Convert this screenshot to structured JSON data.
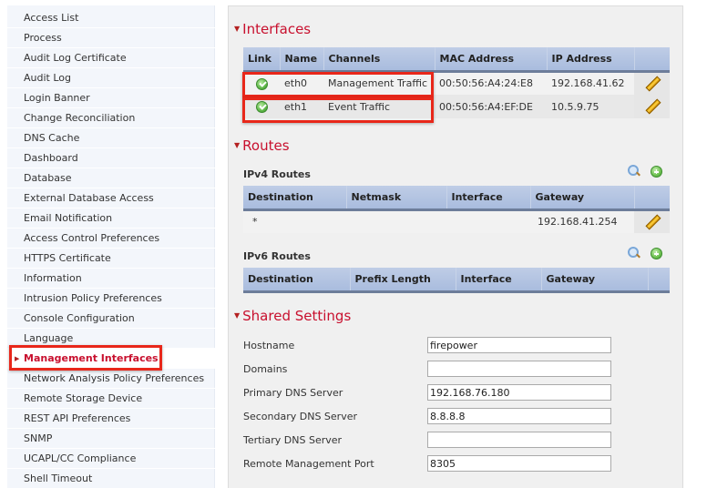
{
  "sidebar": {
    "items": [
      {
        "label": "Access List"
      },
      {
        "label": "Process"
      },
      {
        "label": "Audit Log Certificate"
      },
      {
        "label": "Audit Log"
      },
      {
        "label": "Login Banner"
      },
      {
        "label": "Change Reconciliation"
      },
      {
        "label": "DNS Cache"
      },
      {
        "label": "Dashboard"
      },
      {
        "label": "Database"
      },
      {
        "label": "External Database Access"
      },
      {
        "label": "Email Notification"
      },
      {
        "label": "Access Control Preferences"
      },
      {
        "label": "HTTPS Certificate"
      },
      {
        "label": "Information"
      },
      {
        "label": "Intrusion Policy Preferences"
      },
      {
        "label": "Console Configuration"
      },
      {
        "label": "Language"
      },
      {
        "label": "Management Interfaces",
        "active": true
      },
      {
        "label": "Network Analysis Policy Preferences"
      },
      {
        "label": "Remote Storage Device"
      },
      {
        "label": "REST API Preferences"
      },
      {
        "label": "SNMP"
      },
      {
        "label": "UCAPL/CC Compliance"
      },
      {
        "label": "Shell Timeout"
      }
    ]
  },
  "interfaces": {
    "title": "Interfaces",
    "columns": [
      "Link",
      "Name",
      "Channels",
      "MAC Address",
      "IP Address",
      ""
    ],
    "rows": [
      {
        "link": "ok-icon",
        "name": "eth0",
        "channels": "Management Traffic",
        "mac": "00:50:56:A4:24:E8",
        "ip": "192.168.41.62"
      },
      {
        "link": "ok-icon",
        "name": "eth1",
        "channels": "Event Traffic",
        "mac": "00:50:56:A4:EF:DE",
        "ip": "10.5.9.75"
      }
    ]
  },
  "routes": {
    "title": "Routes",
    "ipv4": {
      "title": "IPv4 Routes",
      "columns": [
        "Destination",
        "Netmask",
        "Interface",
        "Gateway",
        ""
      ],
      "rows": [
        {
          "destination": "*",
          "netmask": "",
          "interface": "",
          "gateway": "192.168.41.254"
        }
      ]
    },
    "ipv6": {
      "title": "IPv6 Routes",
      "columns": [
        "Destination",
        "Prefix Length",
        "Interface",
        "Gateway",
        ""
      ],
      "rows": []
    }
  },
  "shared": {
    "title": "Shared Settings",
    "fields": [
      {
        "label": "Hostname",
        "value": "firepower"
      },
      {
        "label": "Domains",
        "value": ""
      },
      {
        "label": "Primary DNS Server",
        "value": "192.168.76.180"
      },
      {
        "label": "Secondary DNS Server",
        "value": "8.8.8.8"
      },
      {
        "label": "Tertiary DNS Server",
        "value": ""
      },
      {
        "label": "Remote Management Port",
        "value": "8305"
      }
    ]
  },
  "colors": {
    "accent": "#c8102e",
    "highlight_box": "#e8271a",
    "header_bg": "#b5c6e3"
  }
}
